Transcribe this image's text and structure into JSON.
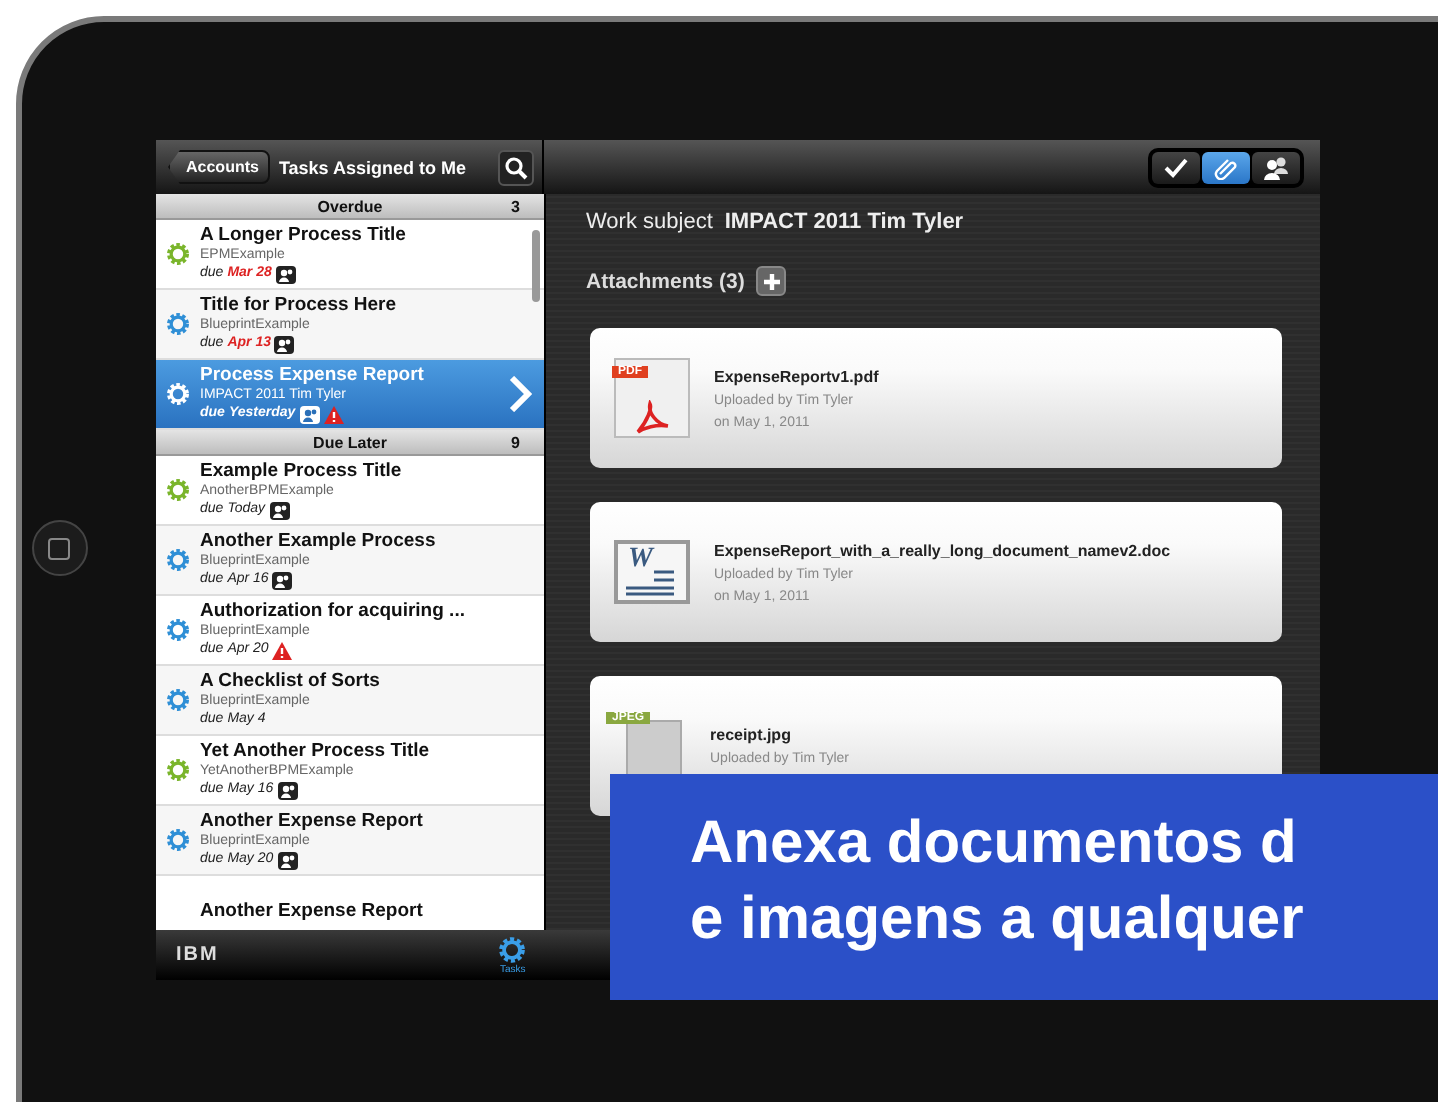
{
  "list_header": {
    "back_button": "Accounts",
    "title": "Tasks Assigned to Me"
  },
  "sections": [
    {
      "title": "Overdue",
      "count": "3",
      "tasks": [
        {
          "title": "A Longer Process Title",
          "process": "EPMExample",
          "due_label": "due",
          "due": "Mar 28",
          "overdue": true,
          "color": "#7ab52b",
          "assigned": true,
          "warning": false,
          "selected": false
        },
        {
          "title": "Title for Process Here",
          "process": "BlueprintExample",
          "due_label": "due",
          "due": "Apr 13",
          "overdue": true,
          "color": "#2f8fd6",
          "assigned": true,
          "warning": false,
          "selected": false
        },
        {
          "title": "Process Expense Report",
          "process": "IMPACT 2011 Tim Tyler",
          "due_label": "due",
          "due": "Yesterday",
          "overdue": false,
          "color": "#2f8fd6",
          "assigned": true,
          "warning": true,
          "selected": true
        }
      ]
    },
    {
      "title": "Due Later",
      "count": "9",
      "tasks": [
        {
          "title": "Example Process Title",
          "process": "AnotherBPMExample",
          "due_label": "due",
          "due": "Today",
          "overdue": false,
          "color": "#7ab52b",
          "assigned": true,
          "warning": false,
          "selected": false
        },
        {
          "title": "Another Example Process",
          "process": "BlueprintExample",
          "due_label": "due",
          "due": "Apr 16",
          "overdue": false,
          "color": "#2f8fd6",
          "assigned": true,
          "warning": false,
          "selected": false
        },
        {
          "title": "Authorization for acquiring ...",
          "process": "BlueprintExample",
          "due_label": "due",
          "due": "Apr 20",
          "overdue": false,
          "color": "#2f8fd6",
          "assigned": false,
          "warning": true,
          "selected": false
        },
        {
          "title": "A Checklist of Sorts",
          "process": "BlueprintExample",
          "due_label": "due",
          "due": "May 4",
          "overdue": false,
          "color": "#2f8fd6",
          "assigned": false,
          "warning": false,
          "selected": false
        },
        {
          "title": "Yet Another Process Title",
          "process": "YetAnotherBPMExample",
          "due_label": "due",
          "due": "May 16",
          "overdue": false,
          "color": "#7ab52b",
          "assigned": true,
          "warning": false,
          "selected": false
        },
        {
          "title": "Another Expense Report",
          "process": "BlueprintExample",
          "due_label": "due",
          "due": "May 20",
          "overdue": false,
          "color": "#2f8fd6",
          "assigned": true,
          "warning": false,
          "selected": false
        },
        {
          "title": "Another Expense Report"
        }
      ]
    }
  ],
  "toolbar_buttons": [
    {
      "kind": "check",
      "selected": false
    },
    {
      "kind": "attach",
      "selected": true
    },
    {
      "kind": "people",
      "selected": false
    }
  ],
  "detail": {
    "subject_label": "Work subject",
    "subject": "IMPACT 2011 Tim Tyler",
    "attachments_label": "Attachments (3)",
    "attachments": [
      {
        "kind": "pdf",
        "icon_label": "PDF",
        "name": "ExpenseReportv1.pdf",
        "uploader": "Uploaded by Tim Tyler",
        "date": "on May 1, 2011"
      },
      {
        "kind": "doc",
        "icon_label": "W",
        "name": "ExpenseReport_with_a_really_long_document_namev2.doc",
        "uploader": "Uploaded by Tim Tyler",
        "date": "on May 1, 2011"
      },
      {
        "kind": "jpeg",
        "icon_label": "JPEG",
        "name": "receipt.jpg",
        "uploader": "Uploaded by Tim Tyler"
      }
    ]
  },
  "tab_bar": {
    "logo": "IBM",
    "tabs": [
      {
        "label": "Tasks",
        "selected": true
      }
    ]
  },
  "caption": {
    "lines": [
      "Anexa documentos d",
      "e imagens a qualquer"
    ]
  }
}
